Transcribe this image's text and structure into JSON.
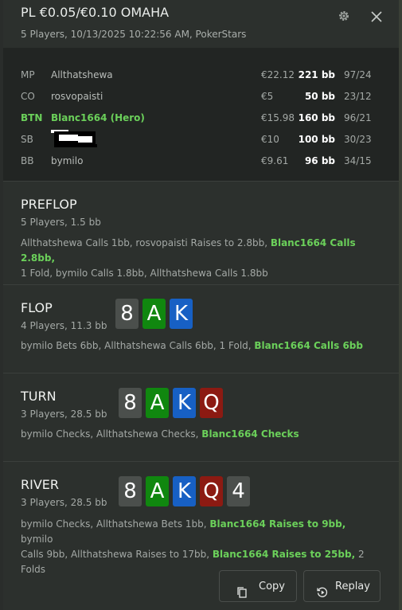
{
  "header": {
    "title": "PL €0.05/€0.10 OMAHA",
    "subtitle": "5 Players, 10/13/2025 10:22:56 AM, PokerStars"
  },
  "players": [
    {
      "pos": "MP",
      "name": "Allthatshewa",
      "stack": "€22.12",
      "bb": "221 bb",
      "stats": "97/24",
      "hero": false
    },
    {
      "pos": "CO",
      "name": "rosvopaisti",
      "stack": "€5",
      "bb": "50 bb",
      "stats": "23/12",
      "hero": false
    },
    {
      "pos": "BTN",
      "name": "Blanc1664 (Hero)",
      "stack": "€15.98",
      "bb": "160 bb",
      "stats": "96/21",
      "hero": true
    },
    {
      "pos": "SB",
      "name": "",
      "stack": "€10",
      "bb": "100 bb",
      "stats": "30/23",
      "hero": false
    },
    {
      "pos": "BB",
      "name": "bymilo",
      "stack": "€9.61",
      "bb": "96 bb",
      "stats": "34/15",
      "hero": false
    }
  ],
  "streets": {
    "preflop": {
      "title": "PREFLOP",
      "sub": "5 Players, 1.5 bb",
      "a1": "Allthatshewa Calls 1bb, rosvopaisti Raises to 2.8bb, ",
      "a2": "Blanc1664 Calls 2.8bb,",
      "a3": "1 Fold, bymilo Calls 1.8bb, Allthatshewa Calls 1.8bb"
    },
    "flop": {
      "title": "FLOP",
      "sub": "4 Players, 11.3 bb",
      "cards": [
        "8",
        "A",
        "K"
      ],
      "a1": "bymilo Bets 6bb, Allthatshewa Calls 6bb, 1 Fold, ",
      "a2": "Blanc1664 Calls 6bb"
    },
    "turn": {
      "title": "TURN",
      "sub": "3 Players, 28.5 bb",
      "cards": [
        "8",
        "A",
        "K",
        "Q"
      ],
      "a1": "bymilo Checks, Allthatshewa Checks, ",
      "a2": "Blanc1664 Checks"
    },
    "river": {
      "title": "RIVER",
      "sub": "3 Players, 28.5 bb",
      "cards": [
        "8",
        "A",
        "K",
        "Q",
        "4"
      ],
      "a1": "bymilo Checks, Allthatshewa Bets 1bb, ",
      "a2": "Blanc1664 Raises to 9bb,",
      "a3": " bymilo",
      "a4": "Calls 9bb, Allthatshewa Raises to 17bb, ",
      "a5": "Blanc1664 Raises to 25bb,",
      "a6": " 2 Folds"
    }
  },
  "buttons": {
    "copy": "Copy",
    "replay": "Replay"
  },
  "icons": {
    "settings": "gear-icon",
    "close": "close-icon",
    "copy": "copy-icon",
    "replay": "replay-icon"
  },
  "colors": {
    "hero": "#6bd05a",
    "card_gray": "#4b4f4c",
    "card_green": "#10870f",
    "card_blue": "#1760c4",
    "card_red": "#8c1a12"
  }
}
